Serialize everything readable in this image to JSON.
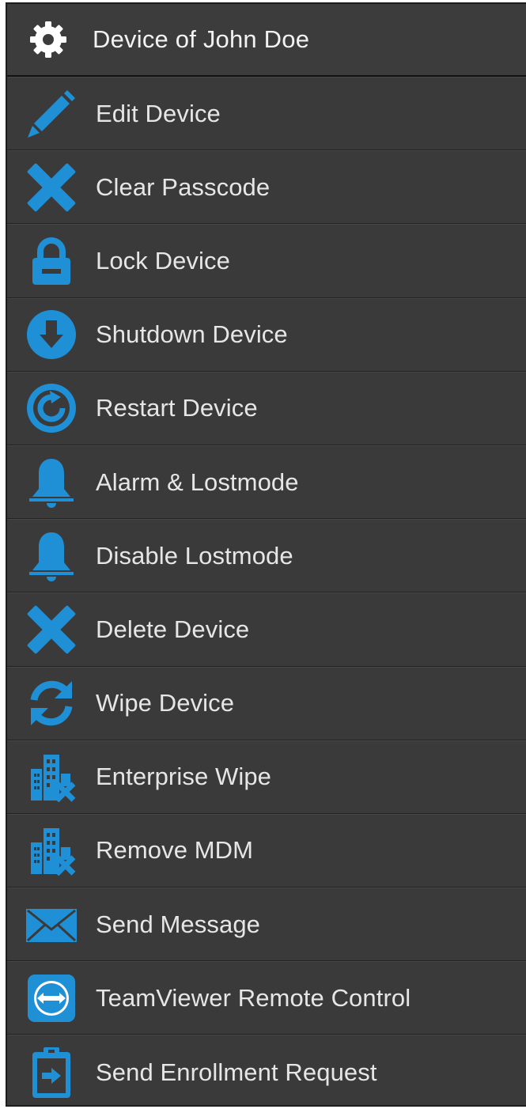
{
  "header": {
    "title": "Device of John Doe",
    "icon": "gear-icon"
  },
  "accent_color": "#1f8fd6",
  "items": [
    {
      "label": "Edit Device",
      "icon": "pencil-icon"
    },
    {
      "label": "Clear Passcode",
      "icon": "x-icon"
    },
    {
      "label": "Lock Device",
      "icon": "lock-icon"
    },
    {
      "label": "Shutdown Device",
      "icon": "arrow-down-circle-icon"
    },
    {
      "label": "Restart Device",
      "icon": "restart-icon"
    },
    {
      "label": "Alarm & Lostmode",
      "icon": "bell-icon"
    },
    {
      "label": "Disable Lostmode",
      "icon": "bell-icon"
    },
    {
      "label": "Delete Device",
      "icon": "x-icon"
    },
    {
      "label": "Wipe Device",
      "icon": "refresh-icon"
    },
    {
      "label": "Enterprise Wipe",
      "icon": "building-x-icon"
    },
    {
      "label": "Remove MDM",
      "icon": "building-x-icon"
    },
    {
      "label": "Send Message",
      "icon": "envelope-icon"
    },
    {
      "label": "TeamViewer Remote Control",
      "icon": "teamviewer-icon"
    },
    {
      "label": "Send Enrollment Request",
      "icon": "clipboard-icon"
    }
  ]
}
